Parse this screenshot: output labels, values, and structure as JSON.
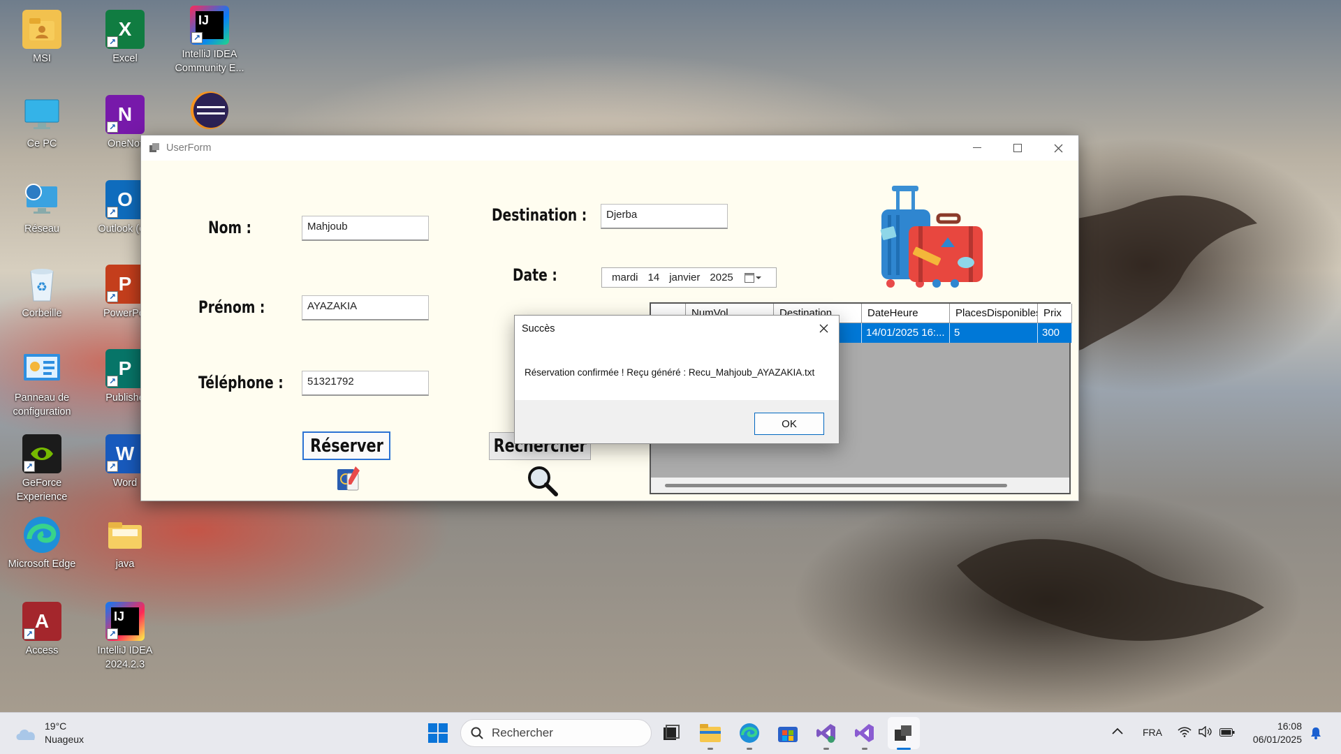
{
  "desktop": {
    "icons": [
      {
        "label": "MSI",
        "icon": "folder-user-icon"
      },
      {
        "label": "Excel",
        "icon": "excel-icon"
      },
      {
        "label": "IntelliJ IDEA Community E...",
        "icon": "intellij-icon"
      },
      {
        "label": "Ce PC",
        "icon": "monitor-icon"
      },
      {
        "label": "OneNot",
        "icon": "onenote-icon"
      },
      {
        "label": "",
        "icon": "eclipse-icon"
      },
      {
        "label": "Réseau",
        "icon": "network-icon"
      },
      {
        "label": "Outlook (cla",
        "icon": "outlook-icon"
      },
      {
        "label": "Corbeille",
        "icon": "recycle-bin-icon"
      },
      {
        "label": "PowerPoi",
        "icon": "powerpoint-icon"
      },
      {
        "label": "Panneau de configuration",
        "icon": "control-panel-icon"
      },
      {
        "label": "Publishe",
        "icon": "publisher-icon"
      },
      {
        "label": "GeForce Experience",
        "icon": "geforce-icon"
      },
      {
        "label": "Word",
        "icon": "word-icon"
      },
      {
        "label": "Microsoft Edge",
        "icon": "edge-icon"
      },
      {
        "label": "java",
        "icon": "folder-icon"
      },
      {
        "label": "Access",
        "icon": "access-icon"
      },
      {
        "label": "IntelliJ IDEA 2024.2.3",
        "icon": "intellij-icon"
      }
    ]
  },
  "window": {
    "title": "UserForm",
    "form": {
      "nom_label": "Nom :",
      "nom_value": "Mahjoub",
      "prenom_label": "Prénom :",
      "prenom_value": "AYAZAKIA",
      "telephone_label": "Téléphone :",
      "telephone_value": "51321792",
      "destination_label": "Destination :",
      "destination_value": "Djerba",
      "date_label": "Date :",
      "date_day_name": "mardi",
      "date_day": "14",
      "date_month": "janvier",
      "date_year": "2025",
      "reserver_button": "Réserver",
      "rechercher_button": "Rechercher"
    },
    "grid": {
      "columns": [
        "",
        "NumVol",
        "Destination",
        "DateHeure",
        "PlacesDisponibles",
        "Prix"
      ],
      "rows": [
        [
          "",
          "",
          "",
          "14/01/2025 16:...",
          "5",
          "300"
        ]
      ]
    }
  },
  "dialog": {
    "title": "Succès",
    "message": "Réservation confirmée ! Reçu généré : Recu_Mahjoub_AYAZAKIA.txt",
    "ok_button": "OK"
  },
  "taskbar": {
    "weather_temp": "19°C",
    "weather_desc": "Nuageux",
    "search_placeholder": "Rechercher",
    "language": "FRA",
    "time": "16:08",
    "date": "06/01/2025"
  }
}
